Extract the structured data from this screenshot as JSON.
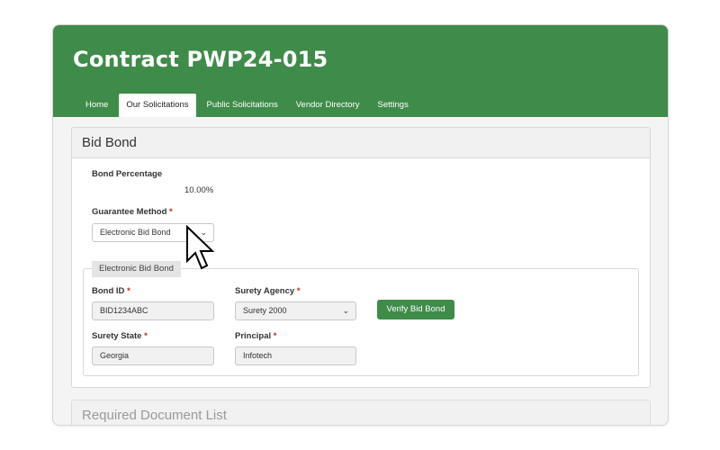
{
  "header": {
    "title": "Contract PWP24-015",
    "color": "#3f8b4a"
  },
  "tabs": [
    {
      "label": "Home"
    },
    {
      "label": "Our Solicitations",
      "active": true
    },
    {
      "label": "Public Solicitations"
    },
    {
      "label": "Vendor Directory"
    },
    {
      "label": "Settings"
    }
  ],
  "bid_bond": {
    "title": "Bid Bond",
    "bond_percentage_label": "Bond Percentage",
    "bond_percentage_value": "10.00%",
    "guarantee_method_label": "Guarantee Method",
    "guarantee_method_value": "Electronic Bid Bond",
    "required_marker": "*",
    "section_legend": "Electronic Bid Bond",
    "bond_id_label": "Bond ID",
    "bond_id_value": "BID1234ABC",
    "surety_agency_label": "Surety Agency",
    "surety_agency_value": "Surety 2000",
    "verify_button": "Verify Bid Bond",
    "surety_state_label": "Surety State",
    "surety_state_value": "Georgia",
    "principal_label": "Principal",
    "principal_value": "Infotech"
  },
  "required_docs": {
    "title": "Required Document List"
  },
  "icons": {
    "dropdown": "chevron-down-icon",
    "cursor": "pointer-cursor-icon"
  }
}
